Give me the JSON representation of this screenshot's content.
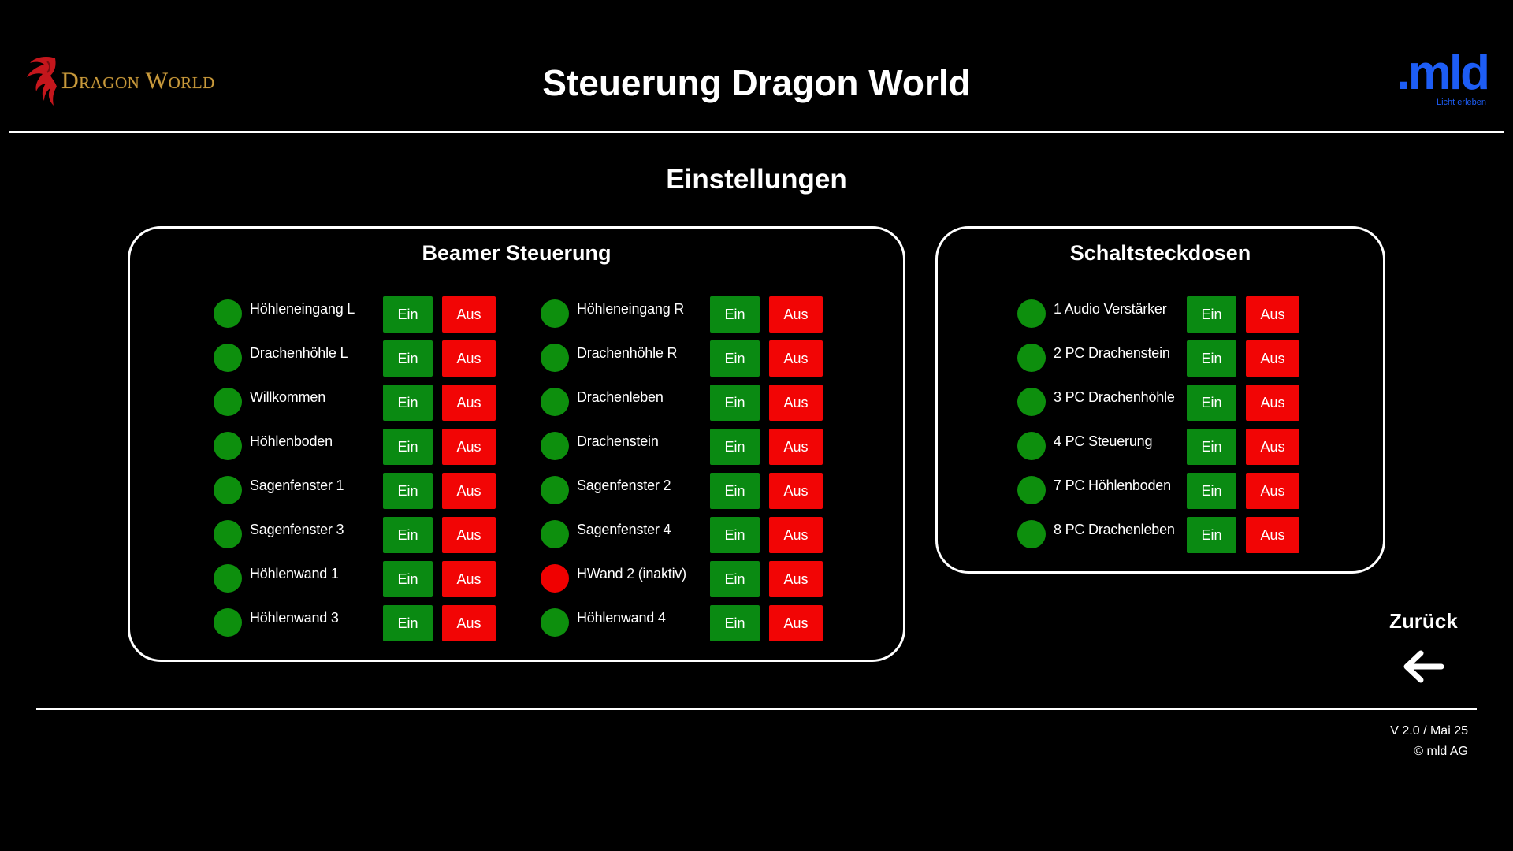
{
  "header": {
    "brand_logo_text": "Dragon World",
    "title": "Steuerung Dragon World",
    "partner_logo_text": ".mld",
    "partner_logo_tagline": "Licht erleben"
  },
  "section_title": "Einstellungen",
  "beamer": {
    "title": "Beamer Steuerung",
    "on_label": "Ein",
    "off_label": "Aus",
    "items": [
      {
        "label": "Höhleneingang L",
        "status": "green"
      },
      {
        "label": "Drachenhöhle L",
        "status": "green"
      },
      {
        "label": "Willkommen",
        "status": "green"
      },
      {
        "label": "Höhlenboden",
        "status": "green"
      },
      {
        "label": "Sagenfenster 1",
        "status": "green"
      },
      {
        "label": "Sagenfenster 3",
        "status": "green"
      },
      {
        "label": "Höhlenwand 1",
        "status": "green"
      },
      {
        "label": "Höhlenwand 3",
        "status": "green"
      },
      {
        "label": "Höhleneingang R",
        "status": "green"
      },
      {
        "label": "Drachenhöhle R",
        "status": "green"
      },
      {
        "label": "Drachenleben",
        "status": "green"
      },
      {
        "label": "Drachenstein",
        "status": "green"
      },
      {
        "label": "Sagenfenster 2",
        "status": "green"
      },
      {
        "label": "Sagenfenster 4",
        "status": "green"
      },
      {
        "label": "HWand 2 (inaktiv)",
        "status": "red"
      },
      {
        "label": "Höhlenwand 4",
        "status": "green"
      }
    ]
  },
  "sockets": {
    "title": "Schaltsteckdosen",
    "on_label": "Ein",
    "off_label": "Aus",
    "items": [
      {
        "label": "1 Audio Verstärker",
        "status": "green"
      },
      {
        "label": "2 PC Drachenstein",
        "status": "green"
      },
      {
        "label": "3 PC Drachenhöhle",
        "status": "green"
      },
      {
        "label": "4 PC Steuerung",
        "status": "green"
      },
      {
        "label": "7 PC Höhlenboden",
        "status": "green"
      },
      {
        "label": "8 PC Drachenleben",
        "status": "green"
      }
    ]
  },
  "back": {
    "label": "Zurück",
    "icon": "arrow-left-icon"
  },
  "footer": {
    "version": "V 2.0 / Mai 25",
    "copyright": "© mld AG"
  },
  "colors": {
    "background": "#000000",
    "status_on": "#0d8f0d",
    "status_off": "#f00000",
    "button_on": "#0a8a12",
    "button_off": "#f20505",
    "brand_gold": "#c89a3c",
    "partner_blue": "#1d5df5"
  }
}
